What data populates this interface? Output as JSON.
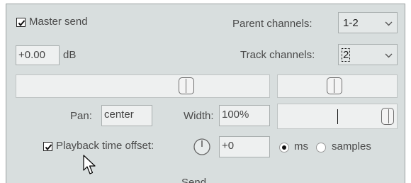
{
  "master_send": {
    "label": "Master send",
    "checked": true
  },
  "parent_channels": {
    "label": "Parent channels:",
    "value": "1-2"
  },
  "volume": {
    "value": "+0.00",
    "unit": "dB"
  },
  "track_channels": {
    "label": "Track channels:",
    "value": "2"
  },
  "pan": {
    "label": "Pan:",
    "value": "center"
  },
  "width": {
    "label": "Width:",
    "value": "100%"
  },
  "playback_offset": {
    "label": "Playback time offset:",
    "checked": true,
    "value": "+0"
  },
  "offset_units": {
    "ms_label": "ms",
    "samples_label": "samples",
    "selected": "ms"
  },
  "partial_label": "Send",
  "icons": {
    "dropdown": "chevron-down-icon",
    "knob": "knob-icon",
    "cursor": "mouse-cursor-icon"
  },
  "colors": {
    "panel_bg": "#d8dede",
    "field_bg": "#eef0f0",
    "border": "#a8aeae"
  }
}
